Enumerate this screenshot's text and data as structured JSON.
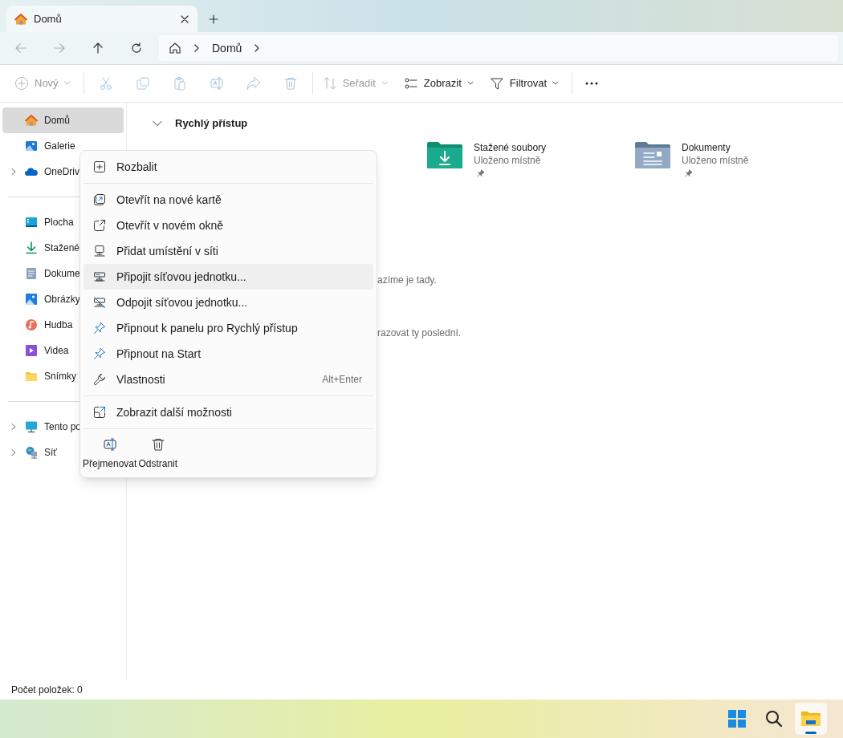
{
  "window": {
    "tab": {
      "title": "Domů",
      "selected": true
    }
  },
  "navigation": {
    "back": {
      "disabled": true
    },
    "forward": {
      "disabled": true
    },
    "up": {
      "disabled": false
    },
    "refresh": {
      "disabled": false
    },
    "breadcrumb": [
      "Domů"
    ]
  },
  "toolbar": [
    {
      "kind": "labeled",
      "label": "Nový",
      "disabled": true,
      "caret": true
    },
    {
      "kind": "icon",
      "disabled": true
    },
    {
      "kind": "icon",
      "disabled": true
    },
    {
      "kind": "icon",
      "disabled": true
    },
    {
      "kind": "icon",
      "disabled": true
    },
    {
      "kind": "icon",
      "disabled": true
    },
    {
      "kind": "icon",
      "disabled": true
    },
    {
      "kind": "labeled",
      "label": "Seřadit",
      "disabled": true,
      "caret": true
    },
    {
      "kind": "labeled",
      "label": "Zobrazit",
      "disabled": false,
      "caret": true
    },
    {
      "kind": "labeled",
      "label": "Filtrovat",
      "disabled": false,
      "caret": true
    },
    {
      "kind": "more",
      "disabled": false
    }
  ],
  "sidebar": {
    "groups": [
      [
        {
          "label": "Domů",
          "selected": true,
          "expandable": false
        },
        {
          "label": "Galerie",
          "selected": false,
          "expandable": false
        },
        {
          "label": "OneDriv",
          "selected": false,
          "expandable": true
        }
      ],
      [
        {
          "label": "Plocha",
          "selected": false,
          "expandable": false
        },
        {
          "label": "Stažené",
          "selected": false,
          "expandable": false
        },
        {
          "label": "Dokume",
          "selected": false,
          "expandable": false
        },
        {
          "label": "Obrázky",
          "selected": false,
          "expandable": false
        },
        {
          "label": "Hudba",
          "selected": false,
          "expandable": false
        },
        {
          "label": "Videa",
          "selected": false,
          "expandable": false
        },
        {
          "label": "Snímky",
          "selected": false,
          "expandable": false
        }
      ],
      [
        {
          "label": "Tento po",
          "selected": false,
          "expandable": true
        },
        {
          "label": "Síť",
          "selected": false,
          "expandable": true
        }
      ]
    ]
  },
  "quick_access": {
    "title": "Rychlý přístup",
    "expanded": true,
    "items": [
      {
        "name": "Stažené soubory",
        "detail": "Uloženo místně",
        "pinned": true
      },
      {
        "name": "Dokumenty",
        "detail": "Uloženo místně",
        "pinned": true
      }
    ],
    "notes": [
      "azíme je tady.",
      "razovat ty poslední."
    ]
  },
  "context_menu": {
    "items": [
      {
        "kind": "item",
        "label": "Rozbalit",
        "selected": false
      },
      {
        "kind": "separator"
      },
      {
        "kind": "item",
        "label": "Otevřít na nové kartě",
        "selected": false
      },
      {
        "kind": "item",
        "label": "Otevřít v novém okně",
        "selected": false
      },
      {
        "kind": "item",
        "label": "Přidat umístění v síti",
        "selected": false
      },
      {
        "kind": "item",
        "label": "Připojit síťovou jednotku...",
        "selected": true
      },
      {
        "kind": "item",
        "label": "Odpojit síťovou jednotku...",
        "selected": false
      },
      {
        "kind": "item",
        "label": "Připnout k panelu pro Rychlý přístup",
        "selected": false
      },
      {
        "kind": "item",
        "label": "Připnout na Start",
        "selected": false
      },
      {
        "kind": "item",
        "label": "Vlastnosti",
        "shortcut": "Alt+Enter",
        "selected": false
      },
      {
        "kind": "separator"
      },
      {
        "kind": "item",
        "label": "Zobrazit další možnosti",
        "selected": false
      },
      {
        "kind": "separator"
      }
    ],
    "actions": [
      "Přejmenovat",
      "Odstranit"
    ]
  },
  "status_bar": {
    "text": "Počet položek: 0"
  },
  "taskbar": [
    {
      "selected": false
    },
    {
      "selected": false
    },
    {
      "selected": true
    }
  ]
}
